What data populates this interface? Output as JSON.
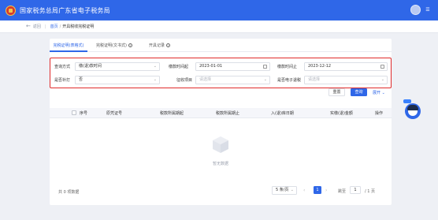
{
  "app": {
    "title": "国家税务总局广东省电子税务局"
  },
  "breadcrumb": {
    "back": "返回",
    "home": "首页",
    "separator": "/",
    "current": "开具税收完税证明"
  },
  "tabs": [
    {
      "label": "完税证明(表格式)",
      "active": true
    },
    {
      "label": "完税证明(文书式)",
      "active": false,
      "info_icon": true
    },
    {
      "label": "开具记录",
      "active": false,
      "info_icon": true
    }
  ],
  "filters": {
    "query_method": {
      "label": "查询方式",
      "value": "缴(退)款时间"
    },
    "start_date": {
      "label": "缴款时间起",
      "value": "2023-01-01"
    },
    "end_date": {
      "label": "缴款时间止",
      "value": "2023-12-12"
    },
    "reissue": {
      "label": "是否补打",
      "value": "否"
    },
    "tax_item": {
      "label": "征收项目",
      "placeholder": "请选择"
    },
    "e_ticket": {
      "label": "是否电子退税",
      "placeholder": "请选择"
    }
  },
  "actions": {
    "reset": "重置",
    "query": "查询",
    "expand": "展开"
  },
  "table": {
    "headers": [
      "序号",
      "原凭证号",
      "税款所属期起",
      "税款所属期止",
      "入(退)库日期",
      "实缴(退)金额",
      "操作"
    ],
    "empty_text": "暂无数据"
  },
  "pagination": {
    "total": "共 0 项数据",
    "page_size": "5 条/页",
    "current_page": "1",
    "jump_label": "跳至",
    "jump_value": "1",
    "page_total": "/ 1 页"
  },
  "colors": {
    "primary": "#2f67e8",
    "highlight_border": "#e02b2b"
  },
  "icons": [
    "logo-emblem",
    "user-avatar",
    "menu-icon",
    "back-arrow-icon",
    "info-icon",
    "calendar-icon",
    "chevron-down-icon",
    "empty-box-icon",
    "assistant-avatar"
  ]
}
